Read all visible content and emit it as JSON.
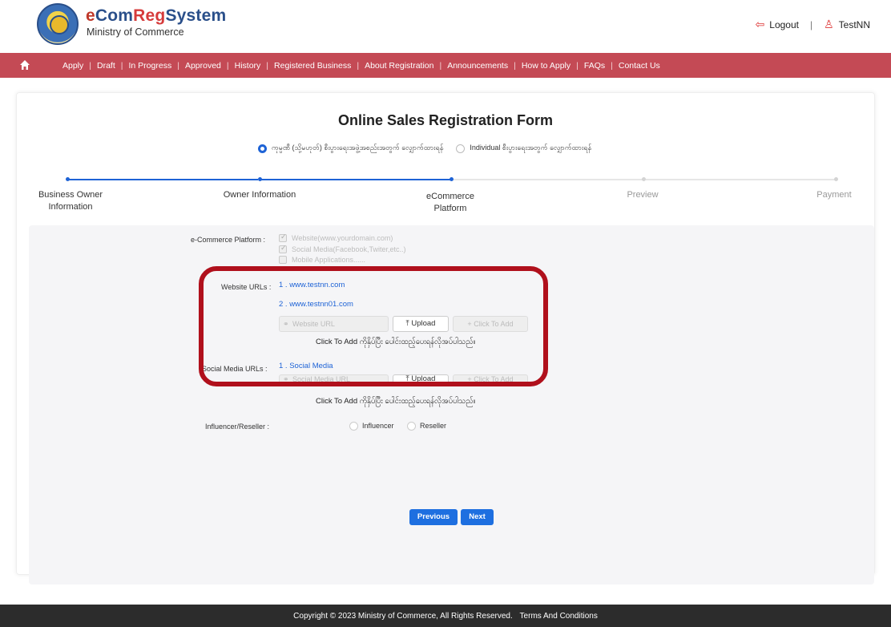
{
  "header": {
    "brand_part1": "e",
    "brand_part2": "Com",
    "brand_part3": "Reg",
    "brand_part4": "System",
    "ministry": "Ministry of Commerce",
    "logout": "Logout",
    "user": "TestNN"
  },
  "nav": {
    "items": [
      "Apply",
      "Draft",
      "In Progress",
      "Approved",
      "History",
      "Registered Business",
      "About Registration",
      "Announcements",
      "How to Apply",
      "FAQs",
      "Contact Us"
    ]
  },
  "form": {
    "title": "Online Sales Registration Form",
    "radio_company": "ကုမ္ပဏီ (သို့မဟုတ်) စီးပွားရေးအဖွဲ့အစည်းအတွက် လျှောက်ထားရန်",
    "radio_individual": "Individual စီးပွားရေးအတွက် လျှောက်ထားရန်"
  },
  "steps": [
    {
      "label_line1": "Business Owner",
      "label_line2": "Information"
    },
    {
      "label_line1": "Owner Information",
      "label_line2": ""
    },
    {
      "label_line1": "eCommerce",
      "label_line2": "Platform"
    },
    {
      "label_line1": "Preview",
      "label_line2": ""
    },
    {
      "label_line1": "Payment",
      "label_line2": ""
    }
  ],
  "platform": {
    "label": "e-Commerce Platform :",
    "options": [
      "Website(www.yourdomain.com)",
      "Social Media(Facebook,Twiter,etc..)",
      "Mobile Applications......"
    ]
  },
  "website": {
    "label": "Website URLs :",
    "urls": [
      "1 . www.testnn.com",
      "2 . www.testnn01.com"
    ],
    "placeholder": "Website URL",
    "upload": "Upload",
    "add": "Click To Add",
    "hint": "Click To Add ကိုနှိပ်ပြီး ပေါင်းထည့်ပေးရန်လိုအပ်ပါသည်။"
  },
  "social": {
    "label": "Social Media URLs :",
    "urls": [
      "1 . Social Media"
    ],
    "placeholder": "Social Media URL",
    "upload": "Upload",
    "add": "Click To Add",
    "hint": "Click To Add ကိုနှိပ်ပြီး ပေါင်းထည့်ပေးရန်လိုအပ်ပါသည်။"
  },
  "influencer": {
    "label": "Influencer/Reseller :",
    "opt1": "Influencer",
    "opt2": "Reseller"
  },
  "buttons": {
    "previous": "Previous",
    "next": "Next"
  },
  "footer": {
    "copyright": "Copyright © 2023 Ministry of Commerce, All Rights Reserved.",
    "terms": "Terms And Conditions"
  },
  "colors": {
    "nav_bg": "#c44a55",
    "primary": "#1e6fe0",
    "highlight": "#b0101c"
  }
}
